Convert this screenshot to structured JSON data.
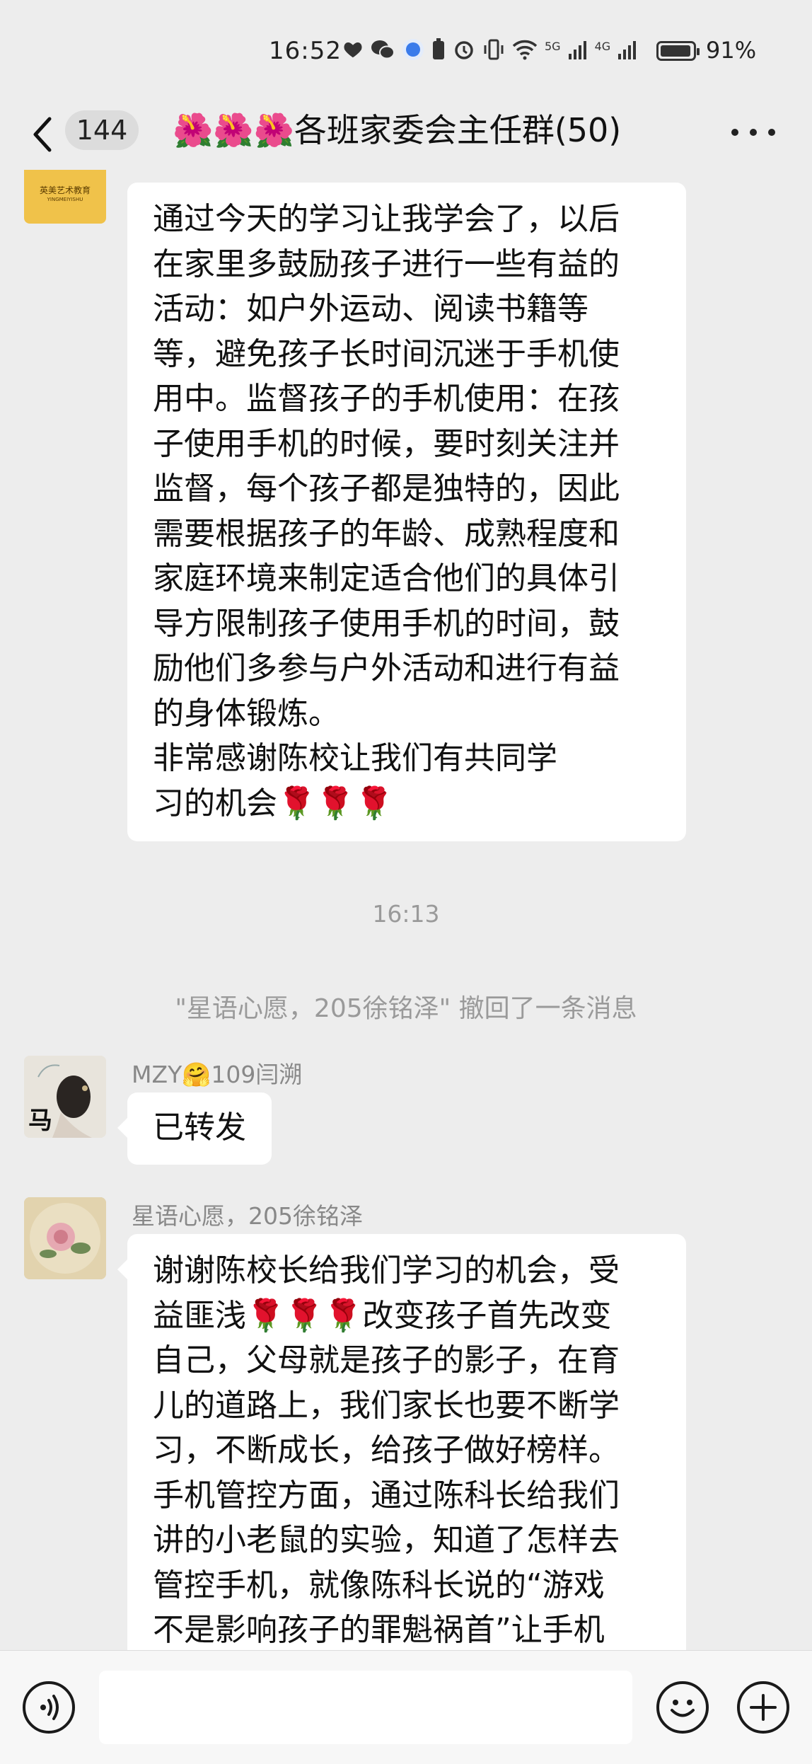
{
  "status_bar": {
    "time": "16:52",
    "network_5g": "5G",
    "network_4g": "4G",
    "battery_percent": "91%",
    "battery_level": 0.91
  },
  "header": {
    "back_count": "144",
    "title": "🌺🌺🌺各班家委会主任群(50)",
    "more_icon": "more-dots-icon"
  },
  "messages": {
    "first": {
      "text": "通过今天的学习让我学会了，以后\n在家里多鼓励孩子进行一些有益的\n活动：如户外运动、阅读书籍等\n等，避免孩子长时间沉迷于手机使\n用中。监督孩子的手机使用：在孩\n子使用手机的时候，要时刻关注并\n监督，每个孩子都是独特的，因此\n需要根据孩子的年龄、成熟程度和\n家庭环境来制定适合他们的具体引\n导方限制孩子使用手机的时间，鼓\n励他们多参与户外活动和进行有益\n的身体锻炼。\n        非常感谢陈校让我们有共同学\n习的机会🌹🌹🌹",
      "avatar_text": "英美艺术教育",
      "avatar_sub": "YINGMEIYISHU"
    },
    "timestamp": "16:13",
    "recall_notice": "\"星语心愿，205徐铭泽\" 撤回了一条消息",
    "second": {
      "sender": "MZY🤗109闫溯",
      "text": "已转发",
      "avatar_char": "马"
    },
    "third": {
      "sender": "星语心愿，205徐铭泽",
      "text": "谢谢陈校长给我们学习的机会，受\n益匪浅🌹🌹🌹改变孩子首先改变\n自己，父母就是孩子的影子，在育\n儿的道路上，我们家长也要不断学\n习，不断成长，给孩子做好榜样。\n手机管控方面，通过陈科长给我们\n讲的小老鼠的实验，知道了怎样去\n管控手机，就像陈科长说的“游戏\n不是影响孩子的罪魁祸首”让手机"
    }
  },
  "input_bar": {
    "voice_icon": "voice-icon",
    "emoji_icon": "emoji-icon",
    "plus_icon": "plus-icon"
  }
}
